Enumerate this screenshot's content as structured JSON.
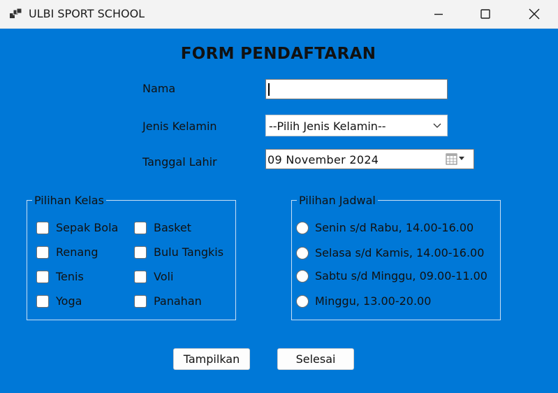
{
  "window": {
    "title": "ULBI SPORT SCHOOL",
    "minimize_icon": "minimize-icon",
    "maximize_icon": "maximize-icon",
    "close_icon": "close-icon"
  },
  "form": {
    "heading": "FORM PENDAFTARAN",
    "nama_label": "Nama",
    "nama_value": "",
    "jenis_kelamin_label": "Jenis Kelamin",
    "jenis_kelamin_selected": "--Pilih Jenis Kelamin--",
    "tanggal_lahir_label": "Tanggal Lahir",
    "tanggal_lahir_value": "09 November  2024"
  },
  "kelas": {
    "title": "Pilihan Kelas",
    "items": [
      {
        "label": "Sepak Bola",
        "checked": false
      },
      {
        "label": "Basket",
        "checked": false
      },
      {
        "label": "Renang",
        "checked": false
      },
      {
        "label": "Bulu Tangkis",
        "checked": false
      },
      {
        "label": "Tenis",
        "checked": false
      },
      {
        "label": "Voli",
        "checked": false
      },
      {
        "label": "Yoga",
        "checked": false
      },
      {
        "label": "Panahan",
        "checked": false
      }
    ]
  },
  "jadwal": {
    "title": "Pilihan Jadwal",
    "items": [
      {
        "label": "Senin s/d Rabu, 14.00-16.00",
        "selected": false
      },
      {
        "label": "Selasa s/d Kamis, 14.00-16.00",
        "selected": false
      },
      {
        "label": "Sabtu s/d Minggu, 09.00-11.00",
        "selected": false
      },
      {
        "label": "Minggu, 13.00-20.00",
        "selected": false
      }
    ]
  },
  "buttons": {
    "tampilkan": "Tampilkan",
    "selesai": "Selesai"
  },
  "colors": {
    "form_background": "#0078d7",
    "titlebar": "#f3f3f3",
    "group_border": "#c9e0f5"
  }
}
